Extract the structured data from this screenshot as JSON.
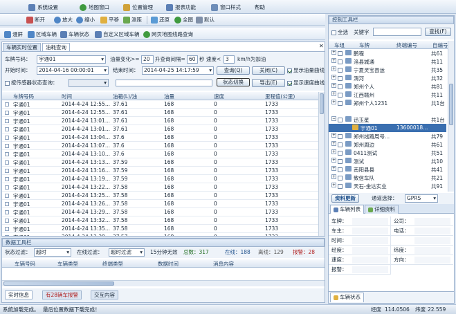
{
  "menu": {
    "items": [
      "系统设置",
      "地图窗口",
      "位置管理",
      "报表功能",
      "窗口样式",
      "帮助"
    ]
  },
  "toolbar": {
    "items": [
      "断开",
      "放大",
      "缩小",
      "平移",
      "测距",
      "还原",
      "全图",
      "默认"
    ]
  },
  "toolbar2": {
    "items": [
      "漫屏",
      "区域车辆",
      "车辆状态",
      "自定义区域车辆",
      "网页地图线路查询"
    ]
  },
  "tabs": [
    "车辆实时位置",
    "油耗查询"
  ],
  "query": {
    "plate_label": "车牌号码：",
    "plate_value": "宇通01",
    "oil_label": "油量变化>=",
    "oil_value": "20",
    "interval_label": "升查询间隔=",
    "interval_value": "60",
    "speed_label": "秒 速度<",
    "speed_value": "3",
    "speed_unit": "km/h为加油",
    "start_label": "开始时间：",
    "start_value": "2014-04-16 00:00:01",
    "end_label": "结束时间：",
    "end_value": "2014-04-25 14:17:59",
    "query_btn": "查询(Q)",
    "close_btn": "关闭(C)",
    "show_oil_curve": "显示油量曲线",
    "by_sensor": "按传感器状态查询：",
    "show_speed_curve": "显示速度曲线",
    "switch_btn": "状态切换",
    "export_btn": "导出(E)"
  },
  "grid": {
    "headers": [
      "车牌号码",
      "时间",
      "油箱(L)/油",
      "油量",
      "速度",
      "里程值(公里)"
    ],
    "rows": [
      [
        "宇通01",
        "2014-4-24 12:55...",
        "37.61",
        "168",
        "0",
        "1733"
      ],
      [
        "宇通01",
        "2014-4-24 12:55...",
        "37.61",
        "168",
        "0",
        "1733"
      ],
      [
        "宇通01",
        "2014-4-24 13:01...",
        "37.61",
        "168",
        "0",
        "1733"
      ],
      [
        "宇通01",
        "2014-4-24 13:01...",
        "37.61",
        "168",
        "0",
        "1733"
      ],
      [
        "宇通01",
        "2014-4-24 13:04...",
        "37.6",
        "168",
        "0",
        "1733"
      ],
      [
        "宇通01",
        "2014-4-24 13:07...",
        "37.6",
        "168",
        "0",
        "1733"
      ],
      [
        "宇通01",
        "2014-4-24 13:10...",
        "37.6",
        "168",
        "0",
        "1733"
      ],
      [
        "宇通01",
        "2014-4-24 13:13...",
        "37.59",
        "168",
        "0",
        "1733"
      ],
      [
        "宇通01",
        "2014-4-24 13:16...",
        "37.59",
        "168",
        "0",
        "1733"
      ],
      [
        "宇通01",
        "2014-4-24 13:19...",
        "37.59",
        "168",
        "0",
        "1733"
      ],
      [
        "宇通01",
        "2014-4-24 13:22...",
        "37.58",
        "168",
        "0",
        "1733"
      ],
      [
        "宇通01",
        "2014-4-24 13:25...",
        "37.58",
        "168",
        "0",
        "1733"
      ],
      [
        "宇通01",
        "2014-4-24 13:26...",
        "37.58",
        "168",
        "0",
        "1733"
      ],
      [
        "宇通01",
        "2014-4-24 13:29...",
        "37.58",
        "168",
        "0",
        "1733"
      ],
      [
        "宇通01",
        "2014-4-24 13:32...",
        "37.58",
        "168",
        "0",
        "1733"
      ],
      [
        "宇通01",
        "2014-4-24 13:35...",
        "37.58",
        "168",
        "0",
        "1733"
      ],
      [
        "宇通01",
        "2014-4-24 13:38...",
        "37.57",
        "168",
        "0",
        "1733"
      ]
    ]
  },
  "data_tools": {
    "title": "数据工具栏",
    "state_label": "状态过滤：",
    "state_value": "超时",
    "online_label": "在线过滤：",
    "online_value": "超时过滤",
    "timeout_value": "15分钟无效",
    "total": "总数：317",
    "online": "在线：188",
    "offline": "离线：129",
    "alarm": "报警：28",
    "headers": [
      "车辆号码",
      "车辆类型",
      "终端类型",
      "数据时间",
      "消息内容"
    ],
    "bottom_tabs": [
      "实时信息",
      "有28辆车报警",
      "交互内容"
    ]
  },
  "control": {
    "title": "控制工具栏",
    "all_label": "全选",
    "keyword_label": "关键字",
    "filter_btn": "查找(F)",
    "headers": [
      "车组",
      "车牌",
      "终端编号",
      "自编号"
    ],
    "tree": [
      {
        "name": "鹏程",
        "count": "共61"
      },
      {
        "name": "洛县城通",
        "count": "共11"
      },
      {
        "name": "宁夏灵宝县运",
        "count": "共35"
      },
      {
        "name": "渭河",
        "count": "共32"
      },
      {
        "name": "郑州个人",
        "count": "共81"
      },
      {
        "name": "江西赣州",
        "count": "共11"
      },
      {
        "name": "郑州个人1231",
        "count": "共1台"
      },
      {
        "name": "",
        "count": ""
      },
      {
        "name": "迅玉星",
        "count": "共1台"
      },
      {
        "name": "宇通01",
        "count": "13600018..."
      },
      {
        "name": "郑州线路周号...",
        "count": "共79"
      },
      {
        "name": "郑州周边",
        "count": "共61"
      },
      {
        "name": "0411测试",
        "count": "共51"
      },
      {
        "name": "测试",
        "count": "共10"
      },
      {
        "name": "南阳县县",
        "count": "共41"
      },
      {
        "name": "致信车队",
        "count": "共21"
      },
      {
        "name": "天石-金达实业",
        "count": "共91"
      }
    ],
    "refresh_btn": "资料更新",
    "channel_label": "通道选择：",
    "channel_value": "GPRS",
    "tabs": [
      "车辆列表",
      "详细资料"
    ],
    "detail_fields": [
      "车牌：",
      "公司：",
      "车主：",
      "电话：",
      "时间：",
      "",
      "经度：",
      "纬度：",
      "速度：",
      "方向：",
      "报警："
    ],
    "status_tab": "车辆状态"
  },
  "status": {
    "left": "系统加载完成。",
    "mid": "最后位置数据下载完成！",
    "lon_label": "经度",
    "lon": "114.0506",
    "lat_label": "纬度",
    "lat": "22.559"
  }
}
